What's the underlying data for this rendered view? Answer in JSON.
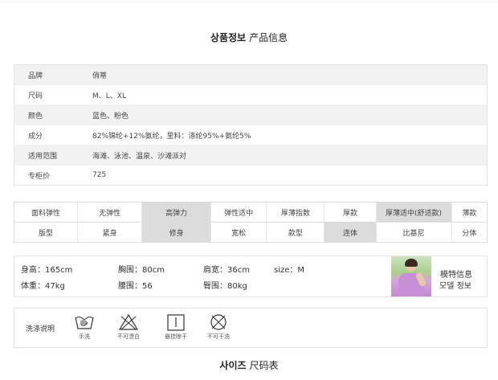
{
  "section_title": {
    "ko": "상품정보",
    "zh": "产品信息"
  },
  "spec_rows": [
    {
      "key": "品牌",
      "value": "俏蒂"
    },
    {
      "key": "尺码",
      "value": "M、L、XL"
    },
    {
      "key": "颜色",
      "value": "蓝色、粉色"
    },
    {
      "key": "成分",
      "value": "82%锦纶+12%氨纶，里料：涤纶95%+氨纶5%"
    },
    {
      "key": "适用范围",
      "value": "海滩、泳池、温泉、沙滩派对"
    },
    {
      "key": "专柜价",
      "value": "725"
    }
  ],
  "tags_row1": [
    {
      "text": "面料弹性",
      "selected": false
    },
    {
      "text": "无弹性",
      "selected": false
    },
    {
      "text": "高弹力",
      "selected": true
    },
    {
      "text": "弹性适中",
      "selected": false
    },
    {
      "text": "厚薄指数",
      "selected": false
    },
    {
      "text": "厚款",
      "selected": false
    },
    {
      "text": "厚薄适中(舒适款)",
      "selected": true
    },
    {
      "text": "薄款",
      "selected": false
    }
  ],
  "tags_row2": [
    {
      "text": "版型",
      "selected": false
    },
    {
      "text": "紧身",
      "selected": false
    },
    {
      "text": "修身",
      "selected": true
    },
    {
      "text": "宽松",
      "selected": false
    },
    {
      "text": "款型",
      "selected": false
    },
    {
      "text": "连体",
      "selected": true
    },
    {
      "text": "比基尼",
      "selected": false
    },
    {
      "text": "分体",
      "selected": false
    }
  ],
  "model_info": {
    "height": "身高：165cm",
    "chest": "胸围：80cm",
    "shoulder": "肩宽：36cm",
    "size": "size：M",
    "weight": "体重：47kg",
    "waist": "腰围：56",
    "hip": "臀围：80kg",
    "label_zh": "模特信息",
    "label_ko": "모델 정보"
  },
  "wash": {
    "label": "洗涤说明",
    "icons": [
      {
        "name": "hand-wash-icon",
        "caption": "手洗"
      },
      {
        "name": "no-bleach-icon",
        "caption": "不可漂白"
      },
      {
        "name": "hang-dry-icon",
        "caption": "悬挂晾干"
      },
      {
        "name": "no-dry-clean-icon",
        "caption": "不可干洗"
      }
    ]
  },
  "size_title": {
    "ko": "사이즈",
    "zh": "尺码表"
  }
}
